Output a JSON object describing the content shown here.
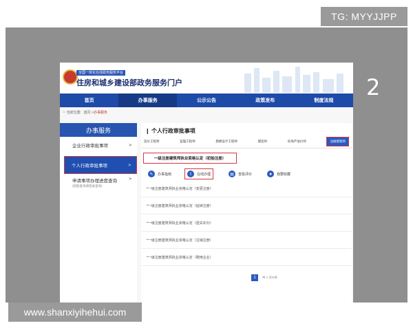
{
  "watermark_top": "TG: MYYJJPP",
  "watermark_bottom": "www.shanxiyihehui.com",
  "annotation_number": "2",
  "site": {
    "stamp": "全国一体化在线政务服务平台",
    "title": "住房和城乡建设部政务服务门户"
  },
  "nav": {
    "items": [
      "首页",
      "办事服务",
      "公示公告",
      "政策发布",
      "制度法规"
    ],
    "active_index": 1
  },
  "breadcrumb": {
    "prefix": "当前位置：首页 >",
    "current": "办事服务"
  },
  "sidebar": {
    "title": "办事服务",
    "items": [
      {
        "label": "企业行政审批事项",
        "arrow": ">"
      },
      {
        "label": "个人行政审批事项",
        "arrow": ">"
      },
      {
        "label": "申请事项办理进度查询",
        "sub": "(智能查询请登录查询)",
        "arrow": ">"
      }
    ],
    "active_index": 1
  },
  "main": {
    "title": "个人行政审批事项",
    "tabs": [
      "造价工程师",
      "监理工程师",
      "勘察设计工程师",
      "建造师",
      "房地产估价师",
      "注册建筑师"
    ],
    "active_tab_index": 5,
    "selected_item": "一级注册建筑师执业资格认定（初始注册）",
    "actions": [
      "办事指南",
      "在线办理",
      "查看评价",
      "我要收藏"
    ],
    "highlighted_action_index": 1,
    "list_items": [
      "一级注册建筑师执业资格认定（变更注册）",
      "一级注册建筑师执业资格认定（延续注册）",
      "一级注册建筑师执业资格认定（遗失补办）",
      "一级注册建筑师执业资格认定（注销注册）",
      "一级注册建筑师执业资格认定（聘用企业）"
    ],
    "pager": {
      "current": "1",
      "info": "共 1 页/5条"
    }
  },
  "colors": {
    "nav_blue": "#1e4aa8",
    "accent_blue": "#2a5ac0",
    "highlight_red": "#d9343e"
  }
}
